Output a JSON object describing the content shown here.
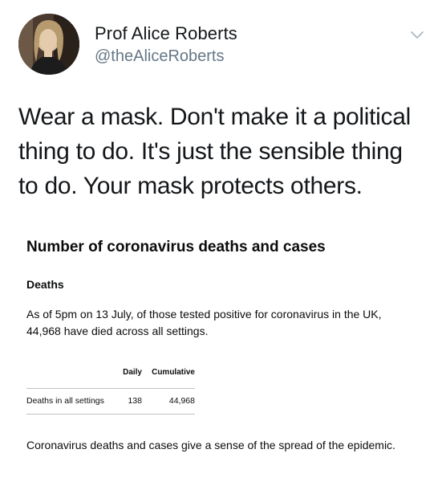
{
  "tweet": {
    "display_name": "Prof Alice Roberts",
    "handle": "@theAliceRoberts",
    "text": "Wear a mask. Don't make it a political thing to do. It's just the sensible thing to do. Your mask protects others."
  },
  "icons": {
    "menu": "chevron-down-icon",
    "avatar": "profile-photo"
  },
  "colors": {
    "name": "#14171a",
    "handle": "#657786",
    "chevron": "#aab8c2",
    "rule": "#bfc1c3"
  },
  "card": {
    "title": "Number of coronavirus deaths and cases",
    "subtitle": "Deaths",
    "paragraph": "As of 5pm on 13 July, of those tested positive for coronavirus in the UK, 44,968 have died across all settings.",
    "table": {
      "headers": [
        "",
        "Daily",
        "Cumulative"
      ],
      "rows": [
        {
          "label": "Deaths in all settings",
          "daily": "138",
          "cumulative": "44,968"
        }
      ]
    },
    "footer": "Coronavirus deaths and cases give a sense of the spread of the epidemic."
  }
}
